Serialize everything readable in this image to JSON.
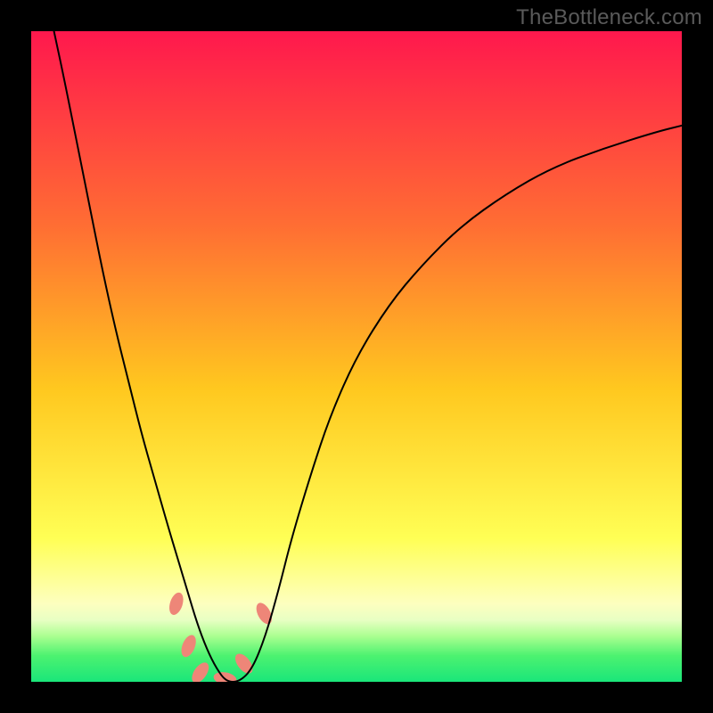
{
  "watermark": "TheBottleneck.com",
  "chart_data": {
    "type": "line",
    "title": "",
    "xlabel": "",
    "ylabel": "",
    "xlim": [
      0,
      100
    ],
    "ylim": [
      0,
      100
    ],
    "grid": false,
    "background_gradient": {
      "stops": [
        {
          "offset": 0.0,
          "color": "#ff184d"
        },
        {
          "offset": 0.3,
          "color": "#ff6e33"
        },
        {
          "offset": 0.55,
          "color": "#ffc81f"
        },
        {
          "offset": 0.78,
          "color": "#ffff55"
        },
        {
          "offset": 0.88,
          "color": "#fdffbf"
        },
        {
          "offset": 0.905,
          "color": "#e8ffc3"
        },
        {
          "offset": 0.93,
          "color": "#aaff90"
        },
        {
          "offset": 0.96,
          "color": "#4cf270"
        },
        {
          "offset": 1.0,
          "color": "#1ae67a"
        }
      ]
    },
    "series": [
      {
        "name": "bottleneck-curve",
        "x": [
          3.5,
          5,
          7,
          9,
          11,
          13,
          15,
          17,
          19,
          21,
          22.5,
          24,
          25.5,
          27,
          28.5,
          30,
          32,
          34,
          36,
          38,
          40,
          43,
          46,
          50,
          55,
          60,
          66,
          73,
          80,
          88,
          96,
          100
        ],
        "y": [
          100,
          93,
          83,
          73,
          63,
          54,
          46,
          38,
          31,
          24,
          19,
          14,
          9,
          5,
          2,
          0,
          0,
          2,
          7,
          14,
          22,
          32,
          41,
          50,
          58,
          64,
          70,
          75,
          79,
          82,
          84.5,
          85.5
        ]
      }
    ],
    "markers": {
      "name": "highlight-segment",
      "color": "#ee8678",
      "points": [
        {
          "x": 22.3,
          "y": 12.0,
          "angle": -72
        },
        {
          "x": 24.2,
          "y": 5.5,
          "angle": -68
        },
        {
          "x": 26.0,
          "y": 1.4,
          "angle": -55
        },
        {
          "x": 29.8,
          "y": 0.5,
          "angle": 10
        },
        {
          "x": 32.7,
          "y": 2.8,
          "angle": 52
        },
        {
          "x": 35.8,
          "y": 10.5,
          "angle": 62
        }
      ],
      "rx": 13,
      "ry": 7
    }
  }
}
